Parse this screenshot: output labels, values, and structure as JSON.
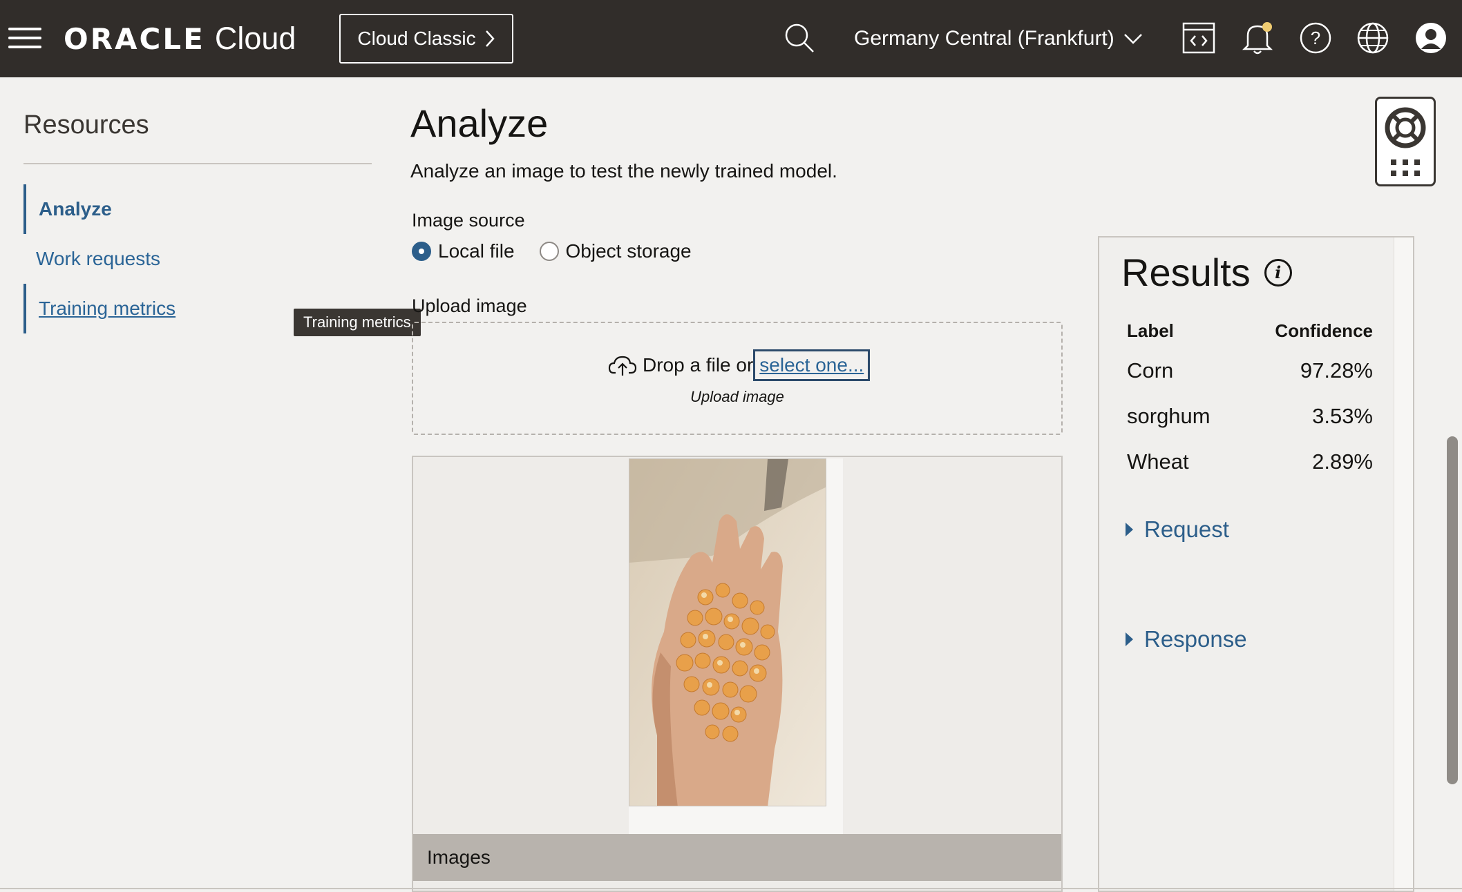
{
  "header": {
    "logo_brand": "ORACLE",
    "logo_product": "Cloud",
    "classic_label": "Cloud Classic",
    "region_label": "Germany Central (Frankfurt)",
    "icons": [
      "menu-icon",
      "search-icon",
      "chevron-down-icon",
      "code-editor-icon",
      "bell-icon",
      "help-icon",
      "globe-icon",
      "user-icon"
    ],
    "notification_dot_color": "#f0cc71"
  },
  "sidebar": {
    "title": "Resources",
    "items": [
      {
        "label": "Analyze"
      },
      {
        "label": "Work requests"
      },
      {
        "label": "Training metrics"
      }
    ],
    "tooltip": "Training metrics"
  },
  "main": {
    "title": "Analyze",
    "description": "Analyze an image to test the newly trained model.",
    "image_source_label": "Image source",
    "radio_local": "Local file",
    "radio_object": "Object storage",
    "selected_source": "Local file",
    "upload_label": "Upload image",
    "drop_text": "Drop a file or",
    "select_link": "select one...",
    "drop_subtext": "Upload image",
    "images_bar_label": "Images"
  },
  "results": {
    "title": "Results",
    "col_label": "Label",
    "col_confidence": "Confidence",
    "rows": [
      {
        "label": "Corn",
        "confidence": "97.28%"
      },
      {
        "label": "sorghum",
        "confidence": "3.53%"
      },
      {
        "label": "Wheat",
        "confidence": "2.89%"
      }
    ],
    "request_label": "Request",
    "response_label": "Response"
  },
  "colors": {
    "header_bg": "#312d2a",
    "page_bg": "#f2f1ef",
    "link_blue": "#2a6496",
    "accent_blue": "#2c5e8a"
  }
}
